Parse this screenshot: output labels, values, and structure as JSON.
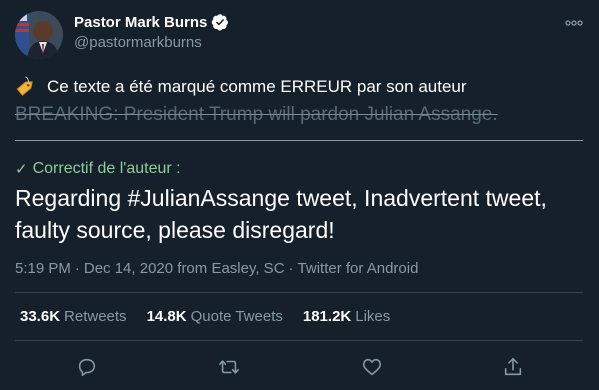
{
  "author": {
    "display_name": "Pastor Mark Burns",
    "handle": "@pastormarkburns",
    "verified": true
  },
  "notice": {
    "icon": "tag-icon",
    "text": "Ce texte a été marqué comme ERREUR par son auteur"
  },
  "original_tweet": {
    "text": "BREAKING: President Trump will pardon Julian Assange."
  },
  "correction": {
    "label": "Correctif de l'auteur :",
    "text": "Regarding #JulianAssange tweet, Inadvertent tweet, faulty source, please disregard!"
  },
  "meta": {
    "time": "5:19 PM",
    "separator": "·",
    "date_location": "Dec 14, 2020 from Easley, SC",
    "source": "Twitter for Android"
  },
  "stats": {
    "retweets_count": "33.6K",
    "retweets_label": "Retweets",
    "quotes_count": "14.8K",
    "quotes_label": "Quote Tweets",
    "likes_count": "181.2K",
    "likes_label": "Likes"
  },
  "colors": {
    "background": "#15202b",
    "secondary_text": "#8899a6",
    "correction_green": "#8ecc96",
    "verified_blue": "#ffffff"
  },
  "actions": [
    "reply-icon",
    "retweet-icon",
    "like-icon",
    "share-icon"
  ]
}
